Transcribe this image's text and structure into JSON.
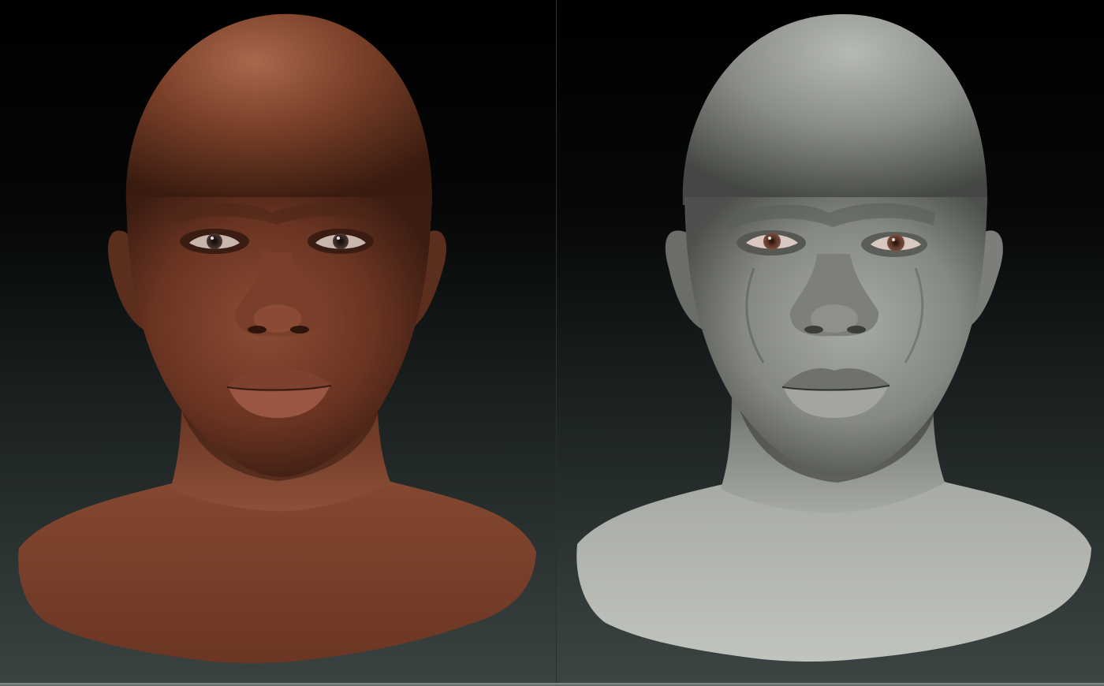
{
  "scene": {
    "panels": [
      {
        "id": "textured-render",
        "material": "skin-texture",
        "background": "#000000"
      },
      {
        "id": "clay-sculpt",
        "material": "gray-clay",
        "background": "#000000"
      }
    ],
    "colors": {
      "skin_base": "#6e3a26",
      "skin_shadow": "#3b1c12",
      "skin_highlight": "#a0634a",
      "clay_base": "#8d908a",
      "clay_shadow": "#4d504c",
      "clay_highlight": "#b9bcb6",
      "iris_dark": "#2a1f1c",
      "iris_brown": "#5a3424",
      "lip_skin": "#8a4838",
      "backdrop_top": "#000000",
      "backdrop_bottom": "#3a4242"
    }
  }
}
